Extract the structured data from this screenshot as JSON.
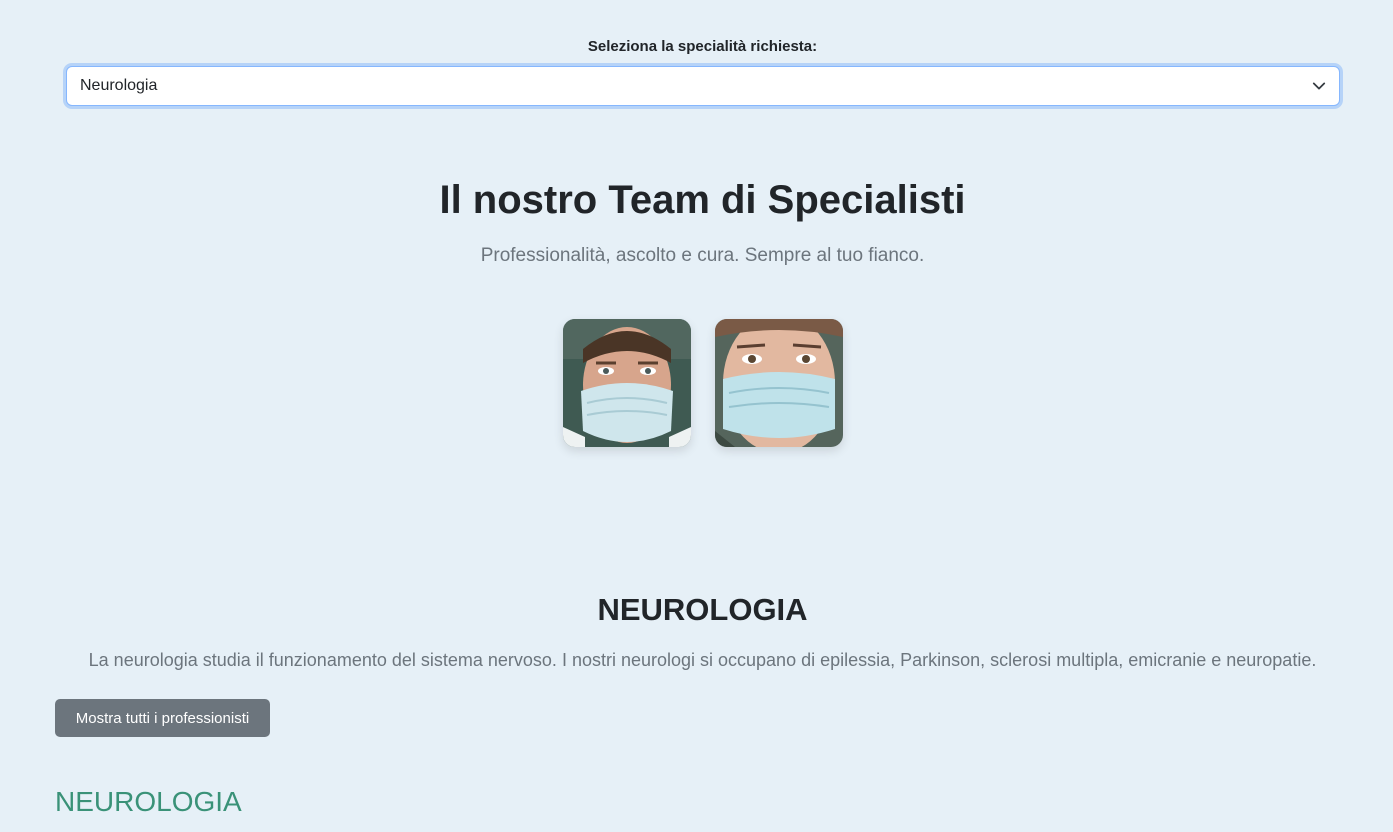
{
  "selector": {
    "label": "Seleziona la specialità richiesta:",
    "selected": "Neurologia"
  },
  "hero": {
    "title": "Il nostro Team di Specialisti",
    "subtitle": "Professionalità, ascolto e cura. Sempre al tuo fianco."
  },
  "team": {
    "members": [
      {
        "photo": "male-doctor-with-mask"
      },
      {
        "photo": "female-doctor-with-mask"
      }
    ]
  },
  "section": {
    "title": "NEUROLOGIA",
    "description": "La neurologia studia il funzionamento del sistema nervoso. I nostri neurologi si occupano di epilessia, Parkinson, sclerosi multipla, emicranie e neuropatie.",
    "button_label": "Mostra tutti i professionisti",
    "category_heading": "NEUROLOGIA"
  },
  "colors": {
    "background": "#e6f0f7",
    "button": "#6c757d",
    "category_accent": "#3a9278",
    "focus_border": "#86b7fe"
  }
}
